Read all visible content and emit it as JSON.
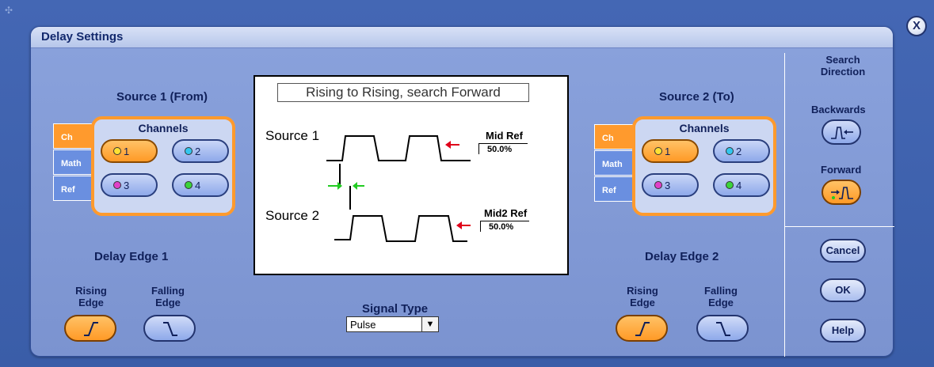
{
  "dialog": {
    "title": "Delay Settings",
    "close_label": "X"
  },
  "source1": {
    "title": "Source 1 (From)",
    "tabs": [
      {
        "label": "Ch",
        "active": true
      },
      {
        "label": "Math",
        "active": false
      },
      {
        "label": "Ref",
        "active": false
      }
    ],
    "channels_label": "Channels",
    "channels": [
      {
        "label": "1",
        "color": "#ffe033",
        "selected": true
      },
      {
        "label": "2",
        "color": "#33c6ee",
        "selected": false
      },
      {
        "label": "3",
        "color": "#e040c8",
        "selected": false
      },
      {
        "label": "4",
        "color": "#3bd43b",
        "selected": false
      }
    ]
  },
  "source2": {
    "title": "Source 2 (To)",
    "tabs": [
      {
        "label": "Ch",
        "active": true
      },
      {
        "label": "Math",
        "active": false
      },
      {
        "label": "Ref",
        "active": false
      }
    ],
    "channels_label": "Channels",
    "channels": [
      {
        "label": "1",
        "color": "#ffe033",
        "selected": true
      },
      {
        "label": "2",
        "color": "#33c6ee",
        "selected": false
      },
      {
        "label": "3",
        "color": "#e040c8",
        "selected": false
      },
      {
        "label": "4",
        "color": "#3bd43b",
        "selected": false
      }
    ]
  },
  "preview": {
    "title": "Rising to Rising, search Forward",
    "source1_label": "Source 1",
    "source2_label": "Source 2",
    "ref1_label": "Mid Ref",
    "ref1_value": "50.0%",
    "ref2_label": "Mid2 Ref",
    "ref2_value": "50.0%"
  },
  "edge1": {
    "title": "Delay Edge 1",
    "rising_label": "Rising\nEdge",
    "falling_label": "Falling\nEdge",
    "selected": "rising"
  },
  "edge2": {
    "title": "Delay Edge 2",
    "rising_label": "Rising\nEdge",
    "falling_label": "Falling\nEdge",
    "selected": "rising"
  },
  "signal_type": {
    "label": "Signal Type",
    "value": "Pulse"
  },
  "search_direction": {
    "title": "Search\nDirection",
    "backwards_label": "Backwards",
    "forward_label": "Forward",
    "selected": "forward"
  },
  "actions": {
    "cancel": "Cancel",
    "ok": "OK",
    "help": "Help"
  },
  "colors": {
    "accent_orange": "#ff9a2d",
    "dialog_bg": "#8aa2dc",
    "arrow_red": "#e0001a",
    "arrow_green": "#22cc22"
  }
}
